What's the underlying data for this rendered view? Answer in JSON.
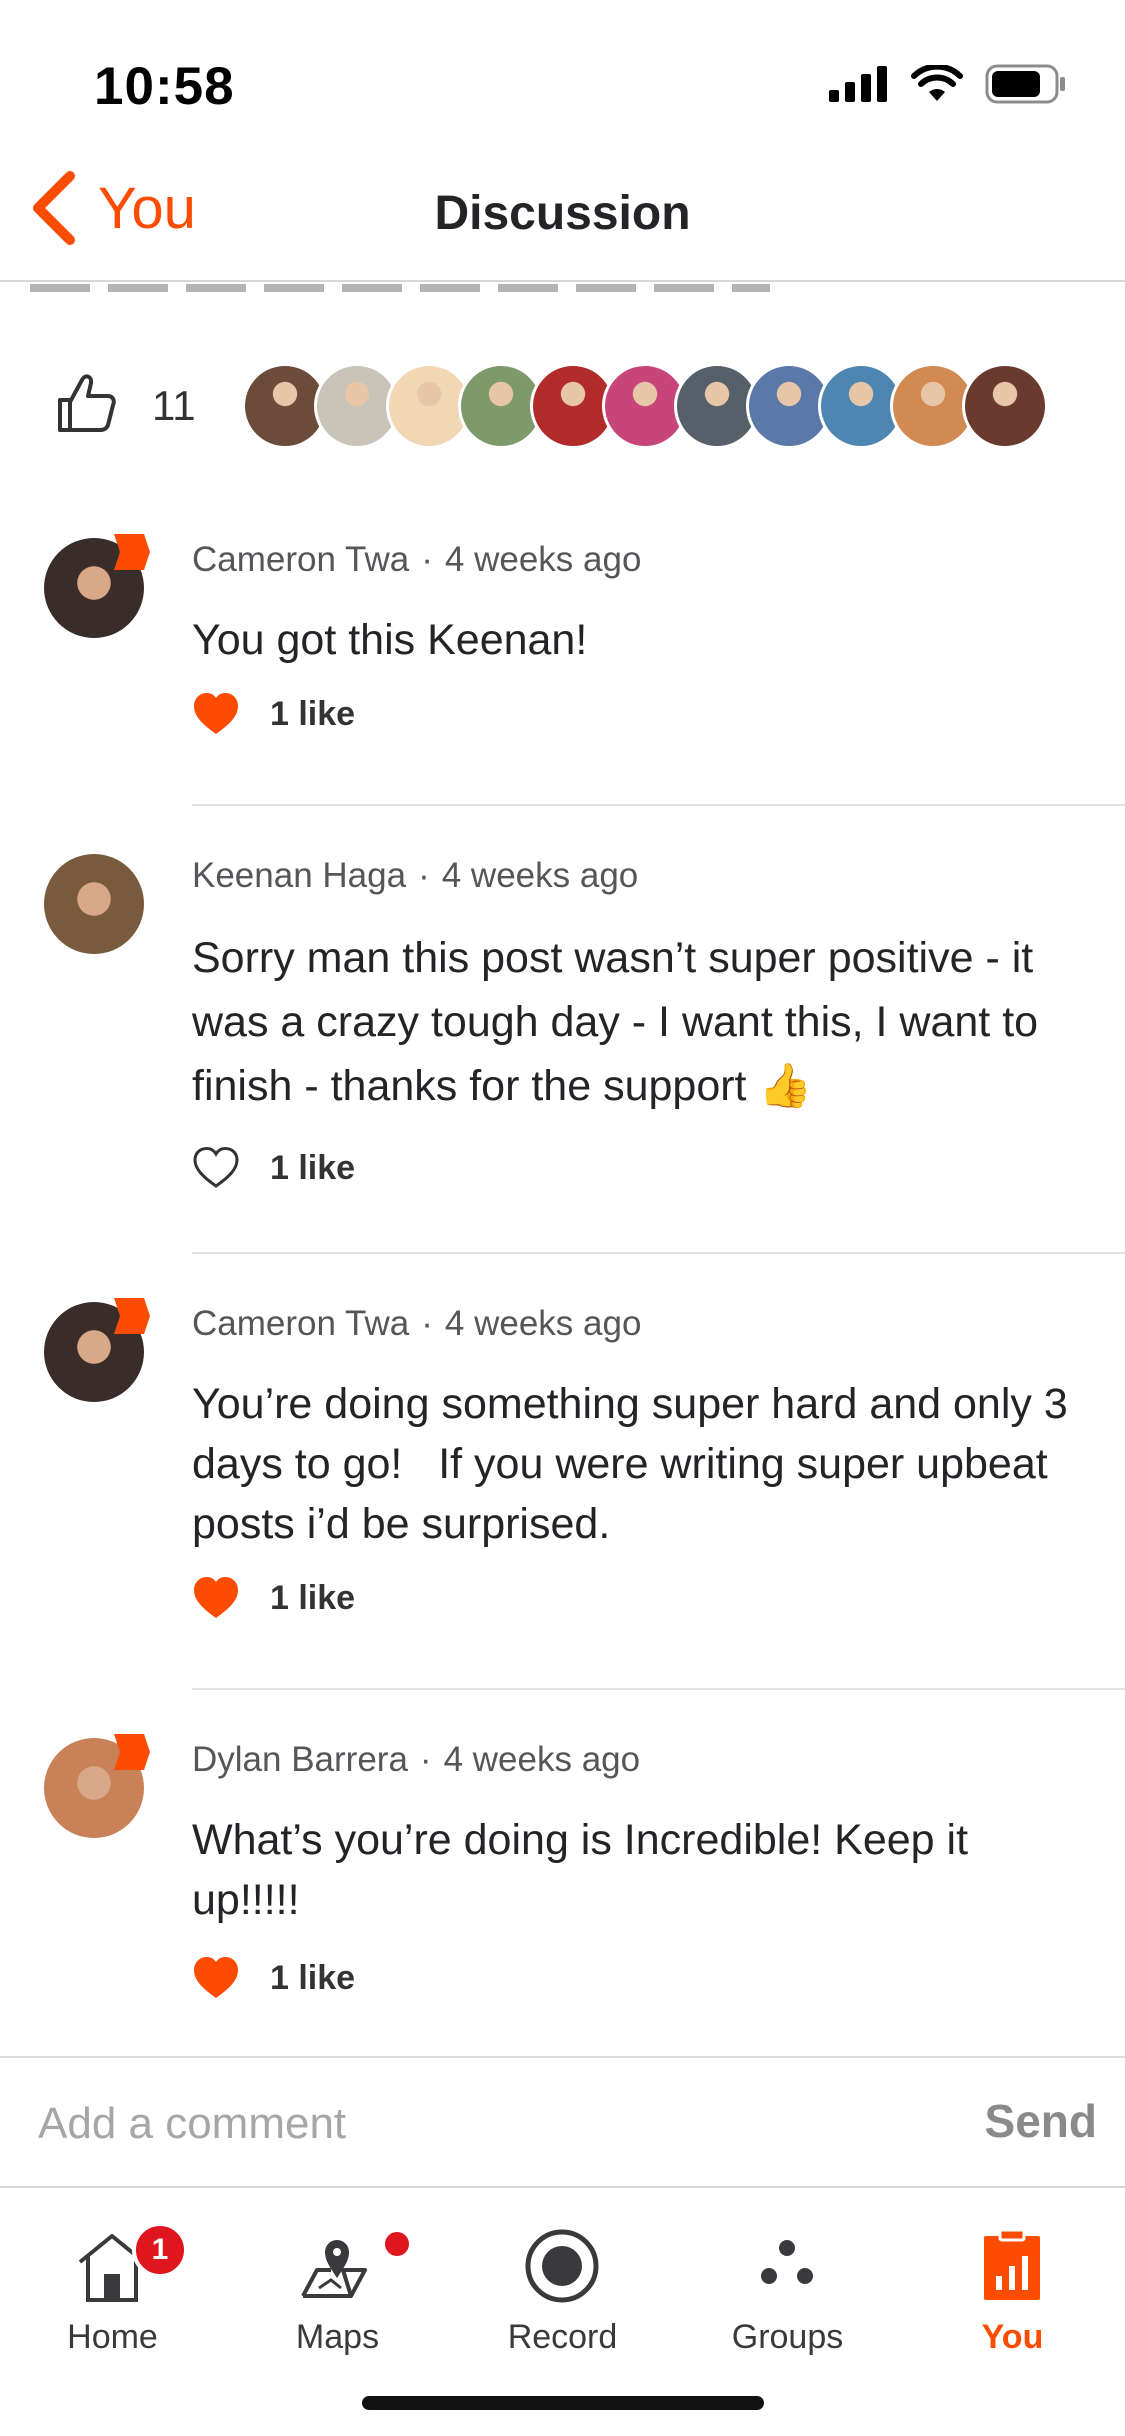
{
  "status_bar": {
    "time": "10:58"
  },
  "header": {
    "back_label": "You",
    "title": "Discussion"
  },
  "kudos": {
    "count": "11",
    "avatars": [
      "#6b4b3a",
      "#c9c3b8",
      "#f2d7b5",
      "#7e9a6a",
      "#b12b2b",
      "#c8457a",
      "#55606b",
      "#5a79a8",
      "#4d86b0",
      "#d38a52",
      "#6b3a2e"
    ]
  },
  "comments": [
    {
      "author": "Cameron Twa",
      "time": "4 weeks ago",
      "text": "You got this Keenan!",
      "likes": "1 like",
      "liked": true,
      "has_badge": true,
      "avatar_color": "#3a2c28"
    },
    {
      "author": "Keenan Haga",
      "time": "4 weeks ago",
      "text": "Sorry man this post wasn’t super positive - it was a crazy tough day - I want this, I want to finish - thanks for the support 👍",
      "likes": "1 like",
      "liked": false,
      "has_badge": false,
      "avatar_color": "#7a5a3c"
    },
    {
      "author": "Cameron Twa",
      "time": "4 weeks ago",
      "text": "You’re doing something super hard and only 3 days to go!   If you were writing super upbeat posts i’d be surprised.",
      "likes": "1 like",
      "liked": true,
      "has_badge": true,
      "avatar_color": "#3a2c28"
    },
    {
      "author": "Dylan Barrera",
      "time": "4 weeks ago",
      "text": "What’s you’re doing is Incredible! Keep it up!!!!!",
      "likes": "1 like",
      "liked": true,
      "has_badge": true,
      "avatar_color": "#c98257"
    }
  ],
  "composer": {
    "placeholder": "Add a comment",
    "send_label": "Send"
  },
  "tabbar": {
    "home": {
      "label": "Home",
      "badge": "1"
    },
    "maps": {
      "label": "Maps"
    },
    "record": {
      "label": "Record"
    },
    "groups": {
      "label": "Groups"
    },
    "you": {
      "label": "You"
    }
  },
  "colors": {
    "accent": "#fc4c02",
    "badge_red": "#e0161e"
  }
}
